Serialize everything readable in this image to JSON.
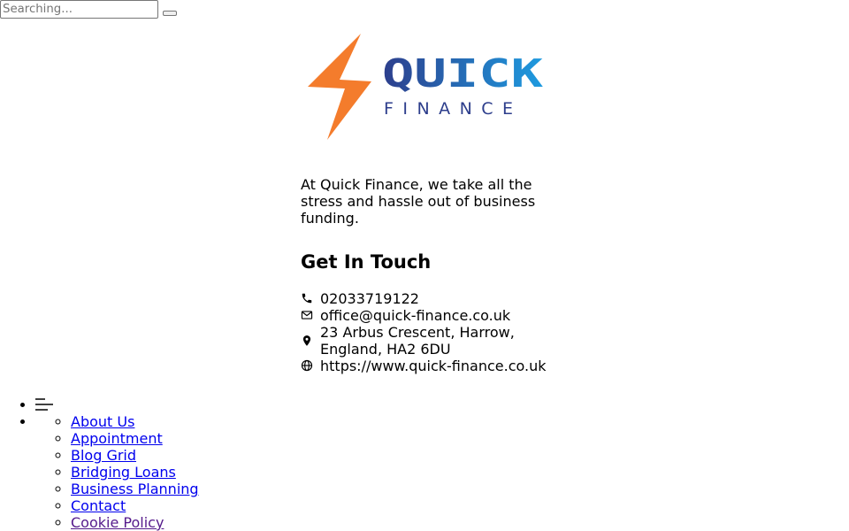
{
  "search": {
    "placeholder": "Searching..."
  },
  "brand": {
    "name_top": "QUICK",
    "name_bottom": "FINANCE",
    "colors": {
      "bolt": "#f47c2c",
      "navy": "#2d3e8c",
      "blue": "#1e9be0"
    }
  },
  "about": {
    "text": "At Quick Finance, we take all the stress and hassle out of business funding."
  },
  "contact": {
    "title": "Get In Touch",
    "items": [
      {
        "icon": "phone-icon",
        "text": "02033719122"
      },
      {
        "icon": "envelope-icon",
        "text": "office@quick-finance.co.uk"
      },
      {
        "icon": "map-pin-icon",
        "text": "23 Arbus Crescent, Harrow, England, HA2 6DU"
      },
      {
        "icon": "globe-icon",
        "text": "https://www.quick-finance.co.uk"
      }
    ]
  },
  "nav": {
    "toggle_icon": "menu-icon",
    "links": [
      {
        "label": "About Us"
      },
      {
        "label": "Appointment"
      },
      {
        "label": "Blog Grid"
      },
      {
        "label": "Bridging Loans"
      },
      {
        "label": "Business Planning"
      },
      {
        "label": "Contact"
      },
      {
        "label": "Cookie Policy"
      }
    ]
  }
}
